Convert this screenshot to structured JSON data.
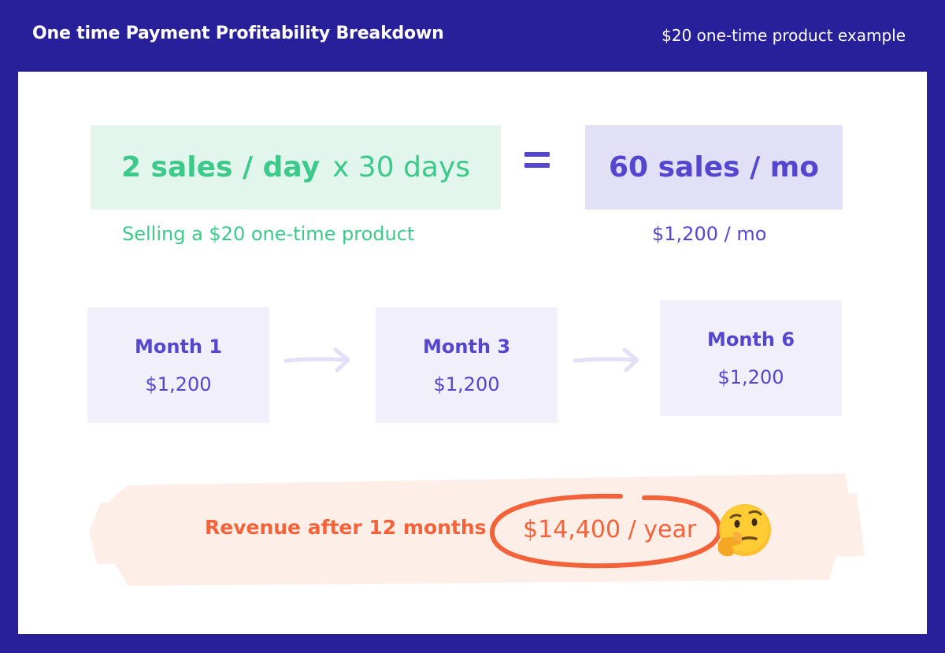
{
  "header": {
    "title": "One time Payment Profitability Breakdown",
    "subtitle": "$20 one-time product example"
  },
  "equation": {
    "left_strong": "2 sales / day",
    "left_rest": "x 30 days",
    "right": "60 sales / mo",
    "left_caption": "Selling a $20 one-time product",
    "right_caption": "$1,200 / mo"
  },
  "months": [
    {
      "label": "Month 1",
      "value": "$1,200"
    },
    {
      "label": "Month 3",
      "value": "$1,200"
    },
    {
      "label": "Month 6",
      "value": "$1,200"
    }
  ],
  "revenue": {
    "label": "Revenue after 12 months",
    "value": "$14,400 / year",
    "emoji": "thinking-face-icon"
  },
  "colors": {
    "background": "#28209a",
    "green": "#3cc98a",
    "green_bg": "#e2f6ee",
    "purple": "#5546d0",
    "purple_bg": "#e2e0f6",
    "month_bg": "#f0effa",
    "orange": "#f4623a",
    "brush": "#fdeee8"
  }
}
